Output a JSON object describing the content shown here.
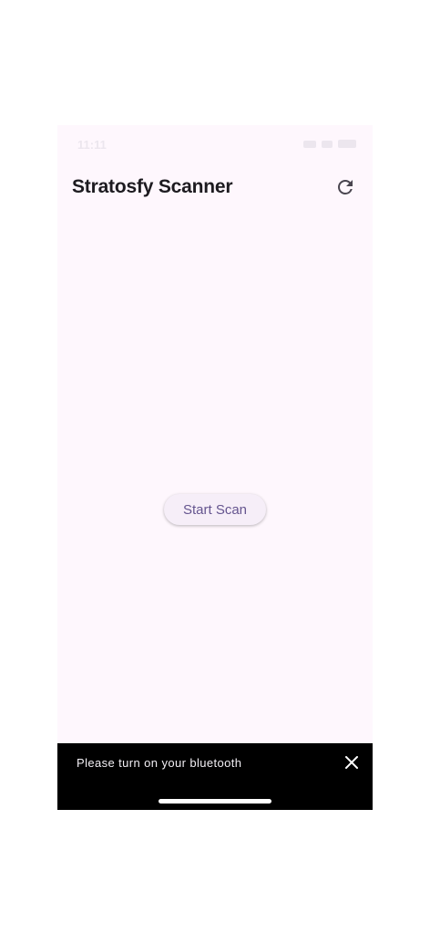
{
  "status_bar": {
    "time": "11:11"
  },
  "app_bar": {
    "title": "Stratosfy Scanner",
    "refresh_icon": "refresh-icon"
  },
  "main": {
    "start_scan_label": "Start Scan"
  },
  "snackbar": {
    "message": "Please turn on your bluetooth",
    "close_icon": "close-icon"
  },
  "colors": {
    "background": "#fef7fd",
    "title": "#1d1b20",
    "button_text": "#65558f",
    "button_bg": "#f6eef8",
    "snackbar_bg": "#000000",
    "snackbar_text": "#f2eff4"
  }
}
